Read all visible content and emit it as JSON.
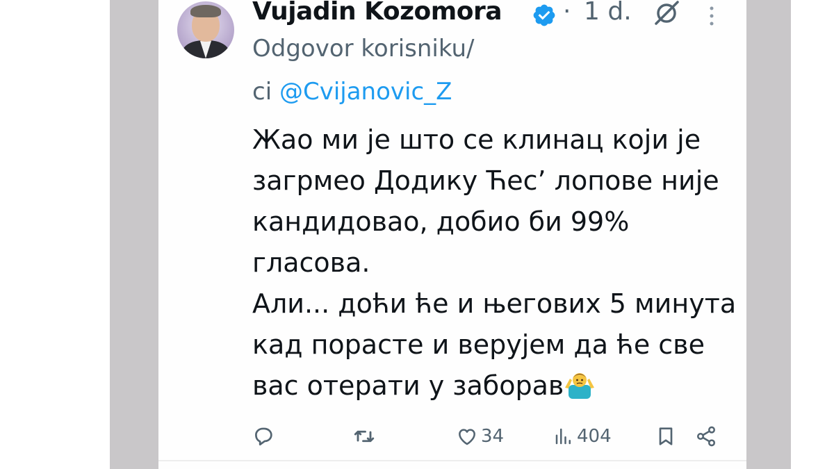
{
  "tweet": {
    "author_name": "Vujadin Kozomora",
    "verified": true,
    "separator": "·",
    "time": "1 d.",
    "reply_prefix_line1": "Odgovor korisniku/",
    "reply_prefix_line2": "ci",
    "reply_to": "@Cvijanovic_Z",
    "text_paragraph_1": "Жао ми је што се клинац који је загрмео Додику Ћес’ лопове није кандидовао, добио би 99% гласова.",
    "text_paragraph_2": "Али... доћи ће и његових 5 минута кад порасте и верујем да ће све вас отерати у заборав",
    "emoji": "man-shrugging-emoji"
  },
  "actions": {
    "reply": {
      "icon": "reply-icon"
    },
    "retweet": {
      "icon": "retweet-icon"
    },
    "like": {
      "icon": "heart-icon",
      "count": "34"
    },
    "views": {
      "icon": "views-icon",
      "count": "404"
    },
    "bookmark": {
      "icon": "bookmark-icon"
    },
    "share": {
      "icon": "share-icon"
    }
  },
  "colors": {
    "accent": "#1d9bf0",
    "secondary_text": "#536471",
    "primary_text": "#0f1419",
    "side_gray": "#c9c7c9"
  }
}
